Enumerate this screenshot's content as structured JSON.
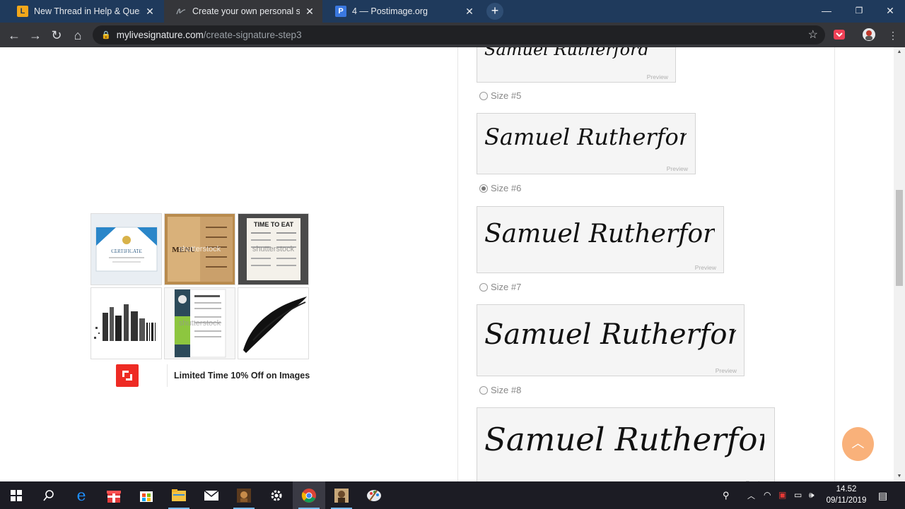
{
  "browser": {
    "tabs": [
      {
        "title": "New Thread in Help & Questions",
        "favicon": "L"
      },
      {
        "title": "Create your own personal signature",
        "favicon": "signature"
      },
      {
        "title": "4 — Postimage.org",
        "favicon": "P"
      }
    ],
    "url_host": "mylivesignature.com",
    "url_path": "/create-signature-step3"
  },
  "ad": {
    "thumb_labels": [
      "CERTIFICATE",
      "MENU",
      "TIME TO EAT"
    ],
    "watermark": "shutterstock",
    "text": "Limited Time 10% Off on Images"
  },
  "signature": {
    "name": "Samuel Rutherford",
    "preview_label": "Preview",
    "sizes": [
      {
        "label": "Size #5",
        "selected": false
      },
      {
        "label": "Size #6",
        "selected": true
      },
      {
        "label": "Size #7",
        "selected": false
      },
      {
        "label": "Size #8",
        "selected": false
      }
    ]
  },
  "taskbar": {
    "time": "14.52",
    "date": "09/11/2019"
  },
  "colors": {
    "tab_strip": "#1f3a5c",
    "toolbar": "#35363a",
    "scroll_top_button": "#f9b17a"
  }
}
